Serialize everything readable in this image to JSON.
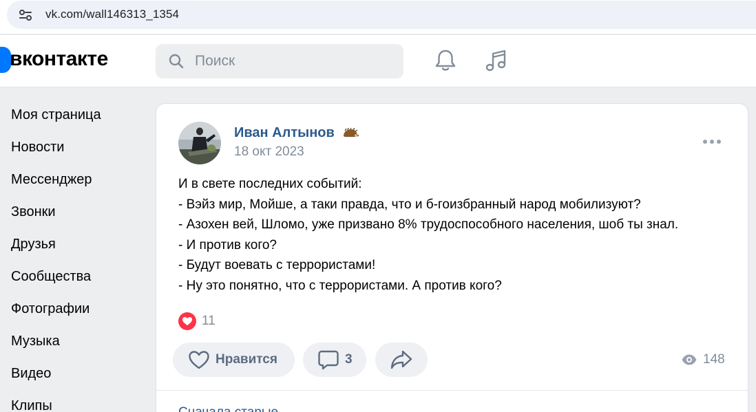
{
  "browser": {
    "url": "vk.com/wall146313_1354"
  },
  "header": {
    "logo_text": "вконтакте",
    "search_placeholder": "Поиск"
  },
  "sidebar": {
    "items": [
      {
        "label": "Моя страница"
      },
      {
        "label": "Новости"
      },
      {
        "label": "Мессенджер"
      },
      {
        "label": "Звонки"
      },
      {
        "label": "Друзья"
      },
      {
        "label": "Сообщества"
      },
      {
        "label": "Фотографии"
      },
      {
        "label": "Музыка"
      },
      {
        "label": "Видео"
      },
      {
        "label": "Клипы"
      }
    ]
  },
  "post": {
    "author": "Иван Алтынов",
    "date": "18 окт 2023",
    "lines": [
      "И в свете последних событий:",
      "- Вэйз мир, Мойше, а таки правда, что и б-гоизбранный народ мобилизуют?",
      "- Азохен вей, Шломо, уже призвано 8% трудоспособного населения, шоб ты знал.",
      "- И против кого?",
      "- Будут воевать с террористами!",
      "- Ну это понятно, что с террористами. А против кого?"
    ],
    "reaction_count": "11",
    "like_label": "Нравится",
    "comment_count": "3",
    "views": "148",
    "sort_label": "Сначала старые"
  },
  "colors": {
    "accent": "#0077ff",
    "author_link": "#2c5a8c",
    "secondary_text": "#818c99",
    "reaction_red": "#ff3347"
  }
}
